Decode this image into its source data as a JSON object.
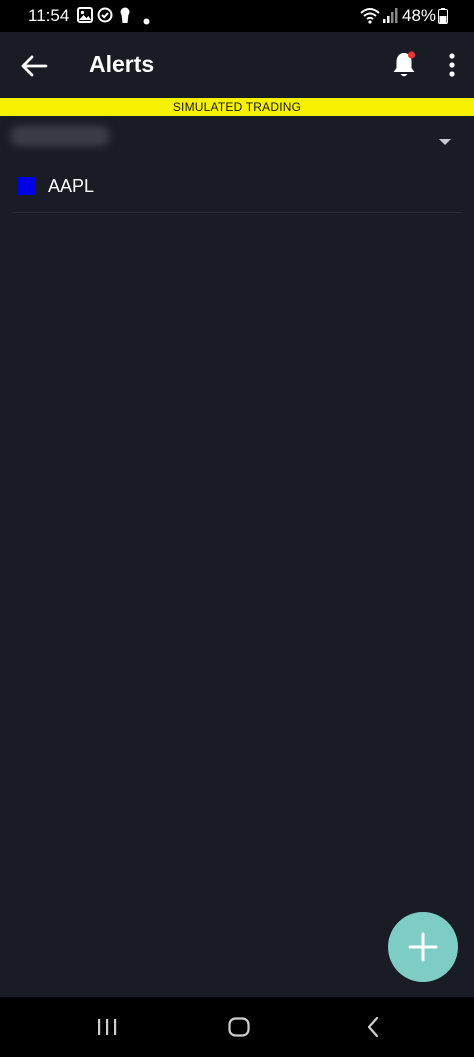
{
  "status_bar": {
    "time": "11:54",
    "battery_percent": "48%"
  },
  "app_bar": {
    "title": "Alerts",
    "notification_dot_color": "#e53935"
  },
  "banner": {
    "text": "SIMULATED TRADING",
    "color": "#f7f000"
  },
  "account_selector": {
    "account_name": "",
    "redacted": true
  },
  "alerts": [
    {
      "symbol": "AAPL",
      "color": "#0000e6"
    }
  ],
  "fab": {
    "icon": "plus-icon",
    "color": "#7ecdc4"
  },
  "nav": {
    "recents": "recents-icon",
    "home": "home-icon",
    "back": "back-icon"
  }
}
